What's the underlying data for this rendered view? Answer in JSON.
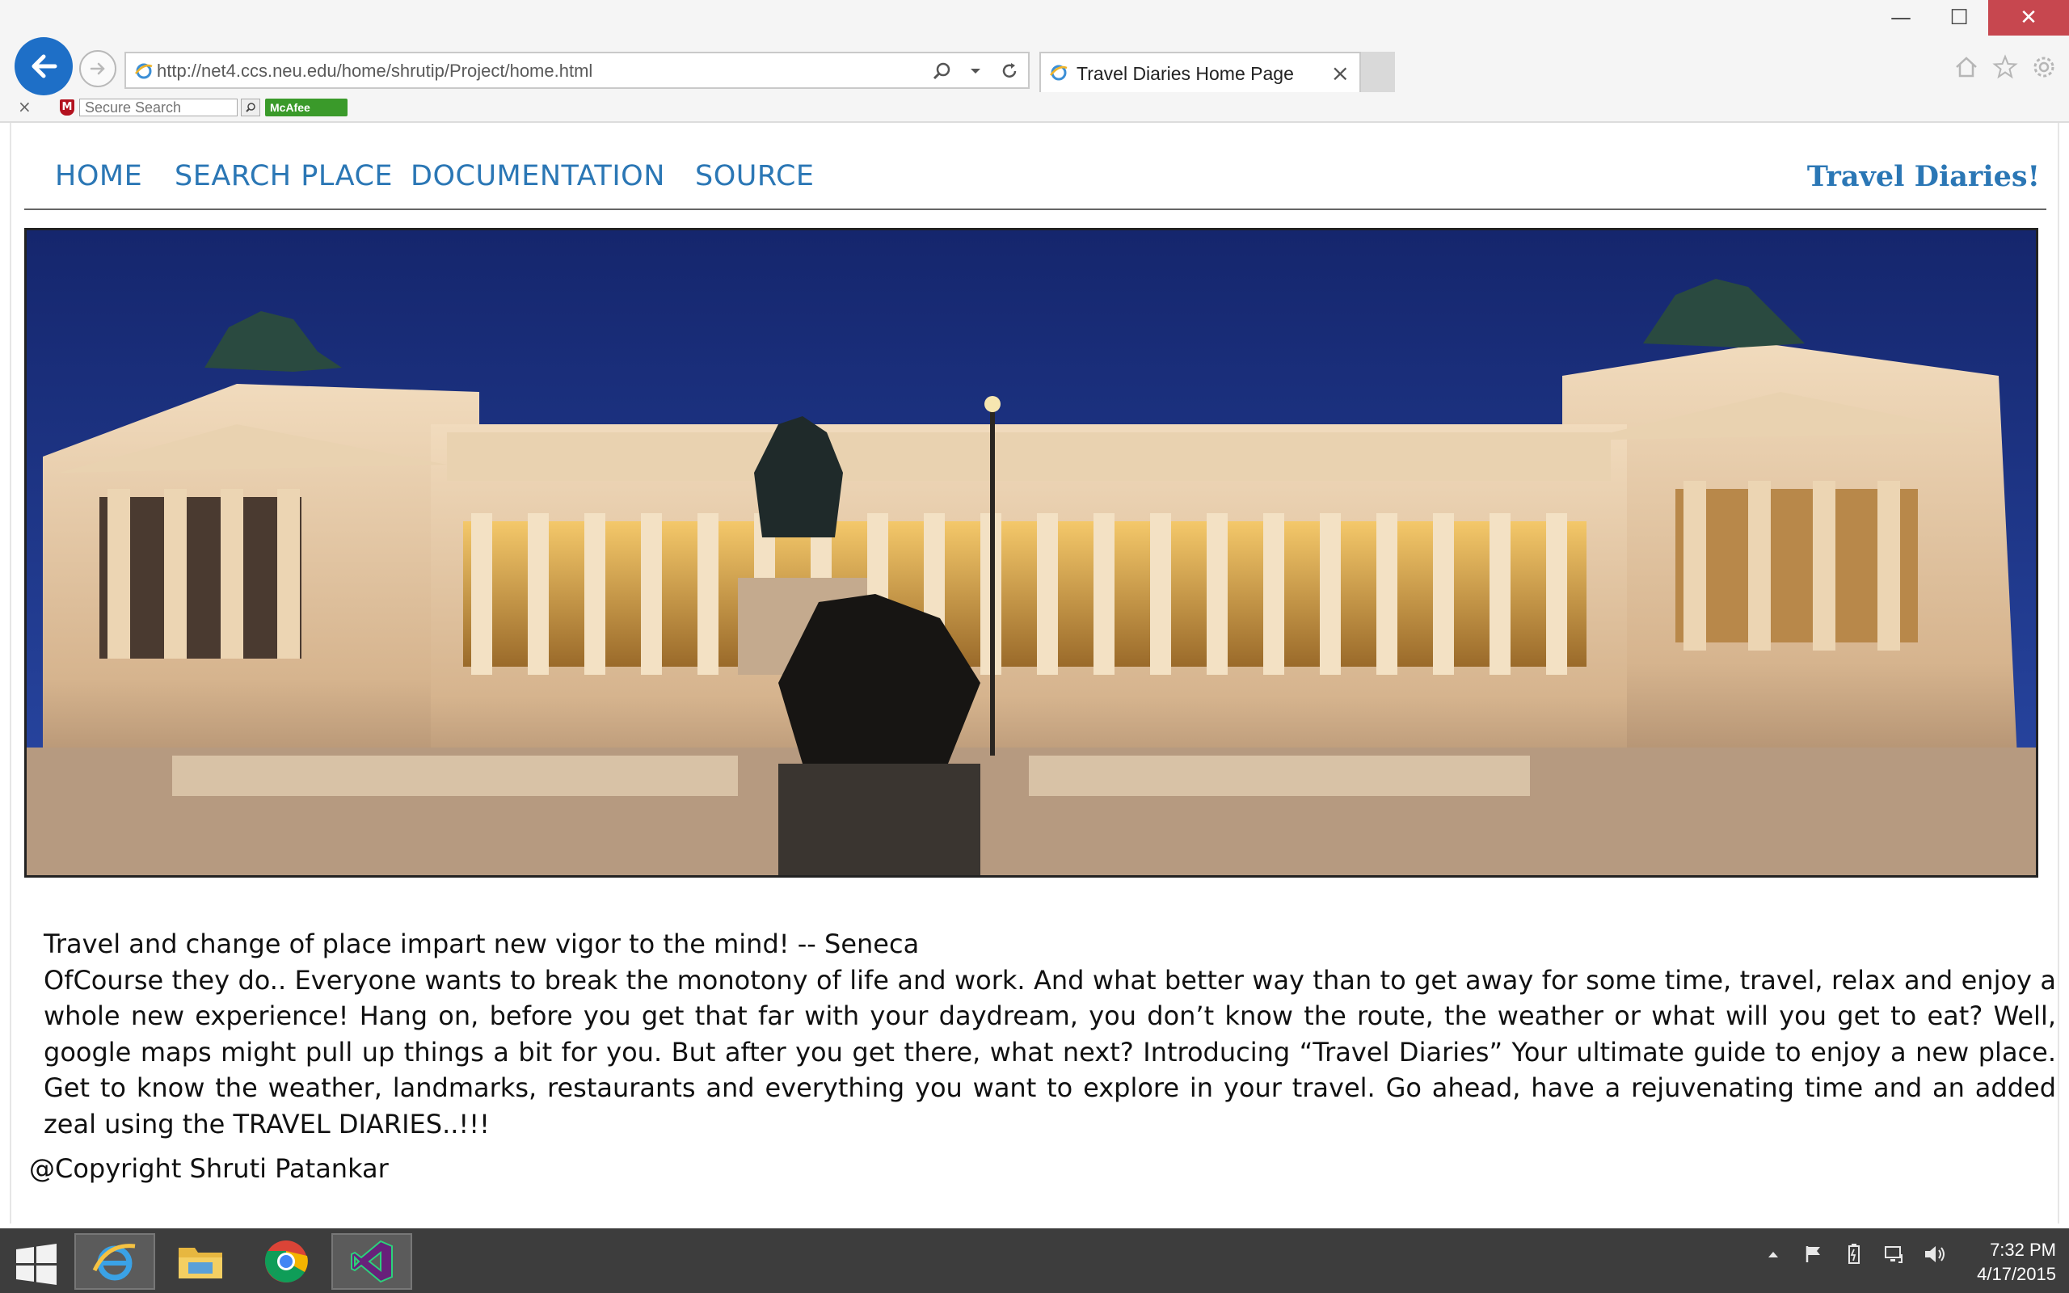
{
  "browser": {
    "address_url": "http://net4.ccs.neu.edu/home/shrutip/Project/home.html",
    "tab_title": "Travel Diaries Home Page",
    "toolbar": {
      "search_placeholder": "Secure Search",
      "mcafee_label": "McAfee"
    }
  },
  "window_controls": {
    "minimize": "—",
    "maximize": "☐",
    "close": "✕"
  },
  "nav": {
    "items": [
      {
        "label": "HOME"
      },
      {
        "label": "SEARCH PLACE"
      },
      {
        "label": "DOCUMENTATION"
      },
      {
        "label": "SOURCE"
      }
    ],
    "brand": "Travel Diaries!"
  },
  "hero": {
    "image_subject": "Altare della Patria, Rome, at dusk",
    "colors": {
      "sky": "#1b2f7a",
      "stone": "#e7c9a5",
      "shadow": "#6a5040"
    }
  },
  "content": {
    "quote": "Travel and change of place impart new vigor to the mind! -- Seneca",
    "paragraph": "OfCourse they do.. Everyone wants to break the monotony of life and work. And what better way than to get away for some time, travel, relax and enjoy a whole new experience! Hang on, before you get that far with your daydream, you don’t know the route, the weather or what will you get to eat? Well, google maps might pull up things a bit for you. But after you get there, what next? Introducing “Travel Diaries” Your ultimate guide to enjoy a new place. Get to know the weather, landmarks, restaurants and everything you want to explore in your travel. Go ahead, have a rejuvenating time and an added zeal using the TRAVEL DIARIES..!!!",
    "copyright": "@Copyright Shruti Patankar"
  },
  "taskbar": {
    "apps": [
      "internet-explorer",
      "file-explorer",
      "chrome",
      "visual-studio"
    ],
    "clock": {
      "time": "7:32 PM",
      "date": "4/17/2015"
    }
  },
  "colors": {
    "link": "#2b77b5",
    "taskbar": "#3d3d3d",
    "close_button": "#c7474f"
  }
}
